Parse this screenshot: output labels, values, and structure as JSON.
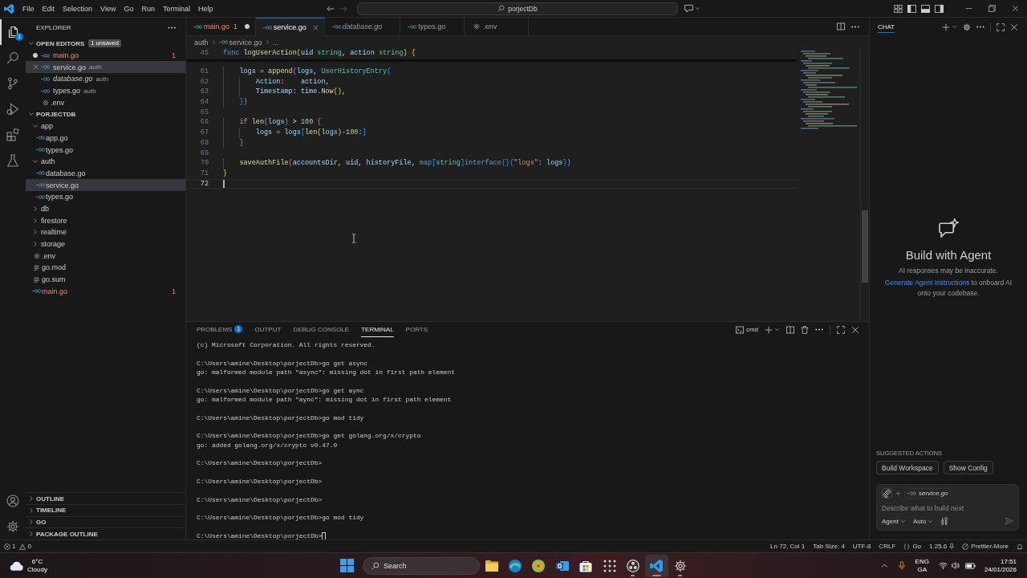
{
  "title_bar": {
    "menu": [
      "File",
      "Edit",
      "Selection",
      "View",
      "Go",
      "Run",
      "Terminal",
      "Help"
    ],
    "search": "porjectDb"
  },
  "activity_bar": {
    "items": [
      {
        "kind": "explorer",
        "selected": true,
        "badge": "1"
      },
      {
        "kind": "search",
        "selected": false
      },
      {
        "kind": "branch",
        "selected": false
      },
      {
        "kind": "debug",
        "selected": false
      },
      {
        "kind": "extensions",
        "selected": false
      },
      {
        "kind": "testing",
        "selected": false
      }
    ],
    "bottom": [
      {
        "kind": "account"
      },
      {
        "kind": "settings"
      }
    ]
  },
  "sidebar": {
    "title": "EXPLORER",
    "open_editors": {
      "title": "OPEN EDITORS",
      "expanded": true,
      "badge": "1 unsaved",
      "items": [
        {
          "name": "main.go",
          "kind": "go",
          "selected": false,
          "unsaved": true,
          "preview": false,
          "error": true,
          "problems": "1"
        },
        {
          "name": "service.go",
          "folder": "auth",
          "kind": "go",
          "selected": true,
          "unsaved": false,
          "preview": false,
          "error": false
        },
        {
          "name": "database.go",
          "folder": "auth",
          "kind": "go",
          "selected": false,
          "unsaved": false,
          "preview": true,
          "error": false
        },
        {
          "name": "types.go",
          "folder": "auth",
          "kind": "go",
          "selected": false,
          "unsaved": false,
          "preview": false,
          "error": false
        },
        {
          "name": ".env",
          "kind": "config",
          "selected": false,
          "unsaved": false,
          "preview": false,
          "error": false
        }
      ]
    },
    "project": {
      "title": "PORJECTDB",
      "expanded": true,
      "children": [
        {
          "name": "app",
          "kind": "folder",
          "expanded": true,
          "selected": false,
          "error": false,
          "children": [
            {
              "name": "app.go",
              "kind": "go",
              "selected": false,
              "error": false
            },
            {
              "name": "types.go",
              "kind": "go",
              "selected": false,
              "error": false
            }
          ]
        },
        {
          "name": "auth",
          "kind": "folder",
          "expanded": true,
          "selected": false,
          "error": false,
          "children": [
            {
              "name": "database.go",
              "kind": "go",
              "selected": false,
              "error": false
            },
            {
              "name": "service.go",
              "kind": "go",
              "selected": true,
              "error": false
            },
            {
              "name": "types.go",
              "kind": "go",
              "selected": false,
              "error": false
            }
          ]
        },
        {
          "name": "db",
          "kind": "folder",
          "expanded": false,
          "selected": false,
          "error": false
        },
        {
          "name": "firestore",
          "kind": "folder",
          "expanded": false,
          "selected": false,
          "error": false
        },
        {
          "name": "realtime",
          "kind": "folder",
          "expanded": false,
          "selected": false,
          "error": false
        },
        {
          "name": "storage",
          "kind": "folder",
          "expanded": false,
          "selected": false,
          "error": false
        },
        {
          "name": ".env",
          "kind": "config",
          "selected": false,
          "error": false
        },
        {
          "name": "go.mod",
          "kind": "text",
          "selected": false,
          "error": false
        },
        {
          "name": "go.sum",
          "kind": "text",
          "selected": false,
          "error": false
        },
        {
          "name": "main.go",
          "kind": "go",
          "selected": false,
          "error": true,
          "problems": "1"
        }
      ]
    },
    "sections": [
      {
        "title": "OUTLINE",
        "expanded": false
      },
      {
        "title": "TIMELINE",
        "expanded": false
      },
      {
        "title": "GO",
        "expanded": false
      },
      {
        "title": "PACKAGE OUTLINE",
        "expanded": false
      }
    ]
  },
  "editor": {
    "tabs": [
      {
        "name": "main.go",
        "kind": "go",
        "selected": false,
        "preview": false,
        "unsaved": true,
        "error": true,
        "problems": "1"
      },
      {
        "name": "service.go",
        "kind": "go",
        "selected": true,
        "preview": false,
        "unsaved": false,
        "error": false
      },
      {
        "name": "database.go",
        "kind": "go",
        "selected": false,
        "preview": true,
        "unsaved": false,
        "error": false
      },
      {
        "name": "types.go",
        "kind": "go",
        "selected": false,
        "preview": false,
        "unsaved": false,
        "error": false
      },
      {
        "name": ".env",
        "kind": "config",
        "selected": false,
        "preview": false,
        "unsaved": false,
        "error": false
      }
    ],
    "breadcrumb": [
      {
        "text": "auth",
        "kind": "folder"
      },
      {
        "text": "service.go",
        "kind": "go"
      },
      {
        "text": "...",
        "kind": "symbol"
      }
    ],
    "sticky": {
      "number": "45",
      "tokens": [
        {
          "kind": "keyword",
          "text": "func"
        },
        {
          "kind": "function",
          "text": " logUserAction"
        },
        {
          "kind": "bracket1",
          "text": "("
        },
        {
          "kind": "variable",
          "text": "uid"
        },
        {
          "kind": "type",
          "text": " string"
        },
        {
          "kind": "plain",
          "text": ", "
        },
        {
          "kind": "variable",
          "text": "action"
        },
        {
          "kind": "type",
          "text": " string"
        },
        {
          "kind": "bracket1",
          "text": ")"
        },
        {
          "kind": "bracket1",
          "text": " {"
        }
      ]
    },
    "lines": [
      {
        "number": "61",
        "current": false,
        "tokens": [
          {
            "kind": "variable",
            "text": "\tlogs"
          },
          {
            "kind": "plain",
            "text": " = "
          },
          {
            "kind": "function",
            "text": "append"
          },
          {
            "kind": "bracket2",
            "text": "("
          },
          {
            "kind": "variable",
            "text": "logs"
          },
          {
            "kind": "plain",
            "text": ", "
          },
          {
            "kind": "type",
            "text": "UserHistoryEntry"
          },
          {
            "kind": "bracket3",
            "text": "{"
          }
        ]
      },
      {
        "number": "62",
        "current": false,
        "tokens": [
          {
            "kind": "variable",
            "text": "\t\tAction"
          },
          {
            "kind": "plain",
            "text": ":    "
          },
          {
            "kind": "variable",
            "text": "action"
          },
          {
            "kind": "plain",
            "text": ","
          }
        ]
      },
      {
        "number": "63",
        "current": false,
        "tokens": [
          {
            "kind": "variable",
            "text": "\t\tTimestamp"
          },
          {
            "kind": "plain",
            "text": ": "
          },
          {
            "kind": "variable",
            "text": "time"
          },
          {
            "kind": "plain",
            "text": "."
          },
          {
            "kind": "function",
            "text": "Now"
          },
          {
            "kind": "bracket1",
            "text": "()"
          },
          {
            "kind": "plain",
            "text": ","
          }
        ]
      },
      {
        "number": "64",
        "current": false,
        "tokens": [
          {
            "kind": "bracket3",
            "text": "\t}"
          },
          {
            "kind": "bracket2",
            "text": ")"
          }
        ]
      },
      {
        "number": "65",
        "current": false
      },
      {
        "number": "66",
        "current": false,
        "tokens": [
          {
            "kind": "control",
            "text": "\tif"
          },
          {
            "kind": "function",
            "text": " len"
          },
          {
            "kind": "bracket2",
            "text": "("
          },
          {
            "kind": "variable",
            "text": "logs"
          },
          {
            "kind": "bracket2",
            "text": ")"
          },
          {
            "kind": "plain",
            "text": " > "
          },
          {
            "kind": "number",
            "text": "100"
          },
          {
            "kind": "bracket2",
            "text": " {"
          }
        ]
      },
      {
        "number": "67",
        "current": false,
        "tokens": [
          {
            "kind": "variable",
            "text": "\t\tlogs"
          },
          {
            "kind": "plain",
            "text": " = "
          },
          {
            "kind": "variable",
            "text": "logs"
          },
          {
            "kind": "bracket3",
            "text": "["
          },
          {
            "kind": "function",
            "text": "len"
          },
          {
            "kind": "bracket1",
            "text": "("
          },
          {
            "kind": "variable",
            "text": "logs"
          },
          {
            "kind": "bracket1",
            "text": ")"
          },
          {
            "kind": "plain",
            "text": "-"
          },
          {
            "kind": "number",
            "text": "100"
          },
          {
            "kind": "plain",
            "text": ":"
          },
          {
            "kind": "bracket3",
            "text": "]"
          }
        ]
      },
      {
        "number": "68",
        "current": false,
        "tokens": [
          {
            "kind": "bracket2",
            "text": "\t}"
          }
        ]
      },
      {
        "number": "69",
        "current": false
      },
      {
        "number": "70",
        "current": false,
        "tokens": [
          {
            "kind": "function",
            "text": "\tsaveAuthFile"
          },
          {
            "kind": "bracket2",
            "text": "("
          },
          {
            "kind": "variable",
            "text": "accountsDir"
          },
          {
            "kind": "plain",
            "text": ", "
          },
          {
            "kind": "variable",
            "text": "uid"
          },
          {
            "kind": "plain",
            "text": ", "
          },
          {
            "kind": "variable",
            "text": "historyFile"
          },
          {
            "kind": "plain",
            "text": ", "
          },
          {
            "kind": "keyword",
            "text": "map"
          },
          {
            "kind": "bracket3",
            "text": "["
          },
          {
            "kind": "type",
            "text": "string"
          },
          {
            "kind": "bracket3",
            "text": "]"
          },
          {
            "kind": "keyword",
            "text": "interface"
          },
          {
            "kind": "bracket3",
            "text": "{}"
          },
          {
            "kind": "bracket3",
            "text": "{"
          },
          {
            "kind": "string",
            "text": "\"logs\""
          },
          {
            "kind": "plain",
            "text": ": "
          },
          {
            "kind": "variable",
            "text": "logs"
          },
          {
            "kind": "bracket3",
            "text": "}"
          },
          {
            "kind": "bracket2",
            "text": ")"
          }
        ]
      },
      {
        "number": "71",
        "current": false,
        "tokens": [
          {
            "kind": "bracket1",
            "text": "}"
          }
        ]
      },
      {
        "number": "72",
        "current": true
      }
    ]
  },
  "panel": {
    "tabs": [
      {
        "label": "PROBLEMS",
        "selected": false,
        "badge": "1"
      },
      {
        "label": "OUTPUT",
        "selected": false
      },
      {
        "label": "DEBUG CONSOLE",
        "selected": false
      },
      {
        "label": "TERMINAL",
        "selected": true
      },
      {
        "label": "PORTS",
        "selected": false
      }
    ],
    "terminal_name": "cmd",
    "terminal": [
      [
        "(c) Microsoft Corporation. All rights reserved."
      ],
      [
        "C:\\Users\\amine\\Desktop\\porjectDb>go get async",
        "go: malformed module path \"async\": missing dot in first path element"
      ],
      [
        "C:\\Users\\amine\\Desktop\\porjectDb>go get aync",
        "go: malformed module path \"aync\": missing dot in first path element"
      ],
      [
        "C:\\Users\\amine\\Desktop\\porjectDb>go mod tidy"
      ],
      [
        "C:\\Users\\amine\\Desktop\\porjectDb>go get golang.org/x/crypto",
        "go: added golang.org/x/crypto v0.47.0"
      ],
      [
        "C:\\Users\\amine\\Desktop\\porjectDb>"
      ],
      [
        "C:\\Users\\amine\\Desktop\\porjectDb>"
      ],
      [
        "C:\\Users\\amine\\Desktop\\porjectDb>"
      ],
      [
        "C:\\Users\\amine\\Desktop\\porjectDb>go mod tidy"
      ],
      [
        "C:\\Users\\amine\\Desktop\\porjectDb>"
      ]
    ]
  },
  "chat": {
    "tabs": [
      {
        "label": "CHAT",
        "selected": true
      }
    ],
    "heading": "Build with Agent",
    "note": "AI responses may be inaccurate.",
    "hint": {
      "link": "Generate Agent Instructions",
      "text": "to onboard AI onto your codebase."
    },
    "suggested_title": "SUGGESTED ACTIONS",
    "suggested_actions": [
      "Build Workspace",
      "Show Config"
    ],
    "composer": {
      "context_file": "service.go",
      "placeholder": "Describe what to build next",
      "mode": "Agent",
      "model": "Auto"
    }
  },
  "status_bar": {
    "errors": "1",
    "warnings": "0",
    "items": [
      {
        "kind": "plain",
        "text": "Ln 72, Col 1"
      },
      {
        "kind": "plain",
        "text": "Tab Size: 4"
      },
      {
        "kind": "plain",
        "text": "UTF-8"
      },
      {
        "kind": "plain",
        "text": "CRLF"
      },
      {
        "kind": "language",
        "text": "Go"
      },
      {
        "kind": "version",
        "text": "1.25.6"
      },
      {
        "kind": "formatter",
        "text": "Prettier-More"
      }
    ]
  },
  "taskbar": {
    "weather": {
      "temperature": "6°C",
      "condition": "Cloudy"
    },
    "search": "Search",
    "apps": [
      {
        "kind": "folder",
        "open": false,
        "selected": false
      },
      {
        "kind": "edge",
        "open": false,
        "selected": false
      },
      {
        "kind": "swirl",
        "open": false,
        "selected": false
      },
      {
        "kind": "mail",
        "open": false,
        "selected": false
      },
      {
        "kind": "store",
        "open": false,
        "selected": false
      },
      {
        "kind": "grid",
        "open": false,
        "selected": false
      },
      {
        "kind": "obs",
        "open": true,
        "selected": false
      },
      {
        "kind": "code",
        "open": true,
        "selected": true
      },
      {
        "kind": "settings",
        "open": true,
        "selected": false
      }
    ],
    "language": [
      "ENG",
      "GA"
    ],
    "time": "17:51",
    "date": "24/01/2026"
  }
}
